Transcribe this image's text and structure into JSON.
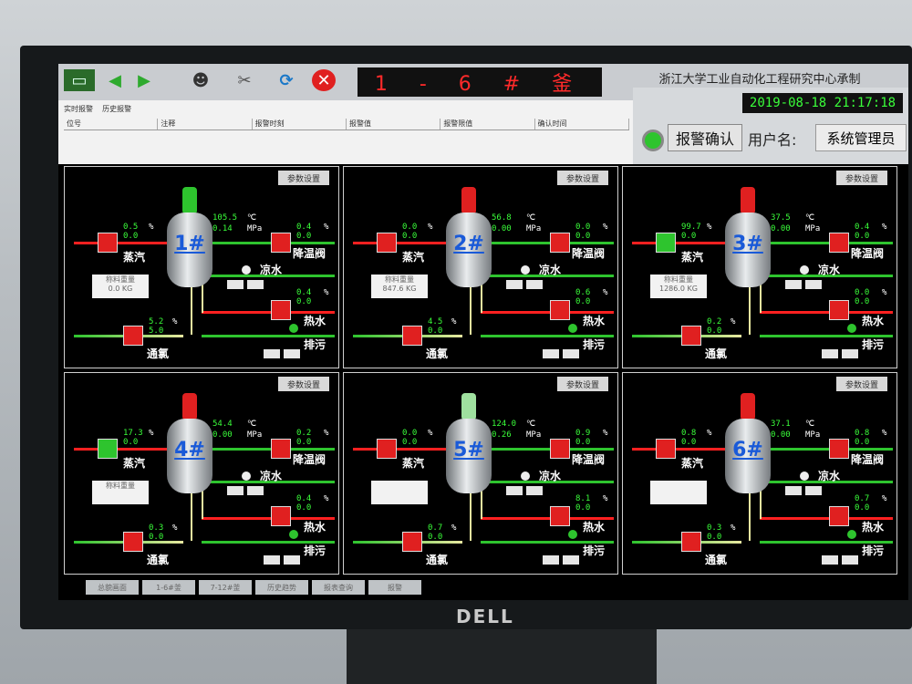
{
  "header": {
    "rig_title": "1 - 6 # 釜",
    "institute": "浙江大学工业自动化工程研究中心承制",
    "datetime": "2019-08-18 21:17:18",
    "ack_button": "报警确认",
    "user_label": "用户名:",
    "user_name": "系统管理员"
  },
  "alarm_panel": {
    "tabs": [
      "实时报警",
      "历史报警"
    ],
    "columns": [
      "位号",
      "注释",
      "报警时刻",
      "报警值",
      "报警限值",
      "确认时间"
    ]
  },
  "panels": [
    {
      "id": "1#",
      "param_btn": "参数设置",
      "temp": "105.5",
      "temp_unit": "℃",
      "press": "0.14",
      "press_unit": "MPa",
      "steam_a": "0.5",
      "steam_b": "0.0",
      "cool_a": "0.4",
      "cool_b": "0.0",
      "hot_a": "0.4",
      "hot_b": "0.0",
      "chlor_a": "5.2",
      "chlor_b": "5.0",
      "pct": "%",
      "weigh_title": "称料重量",
      "weigh_val": "0.0",
      "weigh_unit": "KG"
    },
    {
      "id": "2#",
      "param_btn": "参数设置",
      "temp": "56.8",
      "temp_unit": "℃",
      "press": "0.00",
      "press_unit": "MPa",
      "steam_a": "0.0",
      "steam_b": "0.0",
      "cool_a": "0.0",
      "cool_b": "0.0",
      "hot_a": "0.6",
      "hot_b": "0.0",
      "chlor_a": "4.5",
      "chlor_b": "0.0",
      "pct": "%",
      "weigh_title": "称料重量",
      "weigh_val": "847.6",
      "weigh_unit": "KG"
    },
    {
      "id": "3#",
      "param_btn": "参数设置",
      "temp": "37.5",
      "temp_unit": "℃",
      "press": "0.00",
      "press_unit": "MPa",
      "steam_a": "99.7",
      "steam_b": "0.0",
      "cool_a": "0.4",
      "cool_b": "0.0",
      "hot_a": "0.0",
      "hot_b": "0.0",
      "chlor_a": "0.2",
      "chlor_b": "0.0",
      "pct": "%",
      "weigh_title": "称料重量",
      "weigh_val": "1286.0",
      "weigh_unit": "KG"
    },
    {
      "id": "4#",
      "param_btn": "参数设置",
      "temp": "54.4",
      "temp_unit": "℃",
      "press": "0.00",
      "press_unit": "MPa",
      "steam_a": "17.3",
      "steam_b": "0.0",
      "cool_a": "0.2",
      "cool_b": "0.0",
      "hot_a": "0.4",
      "hot_b": "0.0",
      "chlor_a": "0.3",
      "chlor_b": "0.0",
      "pct": "%",
      "weigh_title": "称料重量",
      "weigh_val": "",
      "weigh_unit": ""
    },
    {
      "id": "5#",
      "param_btn": "参数设置",
      "temp": "124.0",
      "temp_unit": "℃",
      "press": "0.26",
      "press_unit": "MPa",
      "steam_a": "0.0",
      "steam_b": "0.0",
      "cool_a": "0.9",
      "cool_b": "0.0",
      "hot_a": "8.1",
      "hot_b": "0.0",
      "chlor_a": "0.7",
      "chlor_b": "0.0",
      "pct": "%",
      "weigh_title": "",
      "weigh_val": "",
      "weigh_unit": ""
    },
    {
      "id": "6#",
      "param_btn": "参数设置",
      "temp": "37.1",
      "temp_unit": "℃",
      "press": "0.00",
      "press_unit": "MPa",
      "steam_a": "0.8",
      "steam_b": "0.0",
      "cool_a": "0.8",
      "cool_b": "0.0",
      "hot_a": "0.7",
      "hot_b": "0.0",
      "chlor_a": "0.3",
      "chlor_b": "0.0",
      "pct": "%",
      "weigh_title": "",
      "weigh_val": "",
      "weigh_unit": ""
    }
  ],
  "labels": {
    "steam": "蒸汽",
    "cooling_valve": "降温阀",
    "cold_water": "凉水",
    "hot_water": "热水",
    "chlorine": "通氯",
    "drain": "排污",
    "open": "打开",
    "close": "关闭"
  },
  "bottom_tabs": [
    "总貌画面",
    "1-6#釜",
    "7-12#釜",
    "历史趋势",
    "报表查询",
    "报警"
  ],
  "brand": "DELL",
  "colors": {
    "green": "#3aff3a",
    "red": "#ff2020",
    "tank_blue": "#1a5ad8"
  }
}
